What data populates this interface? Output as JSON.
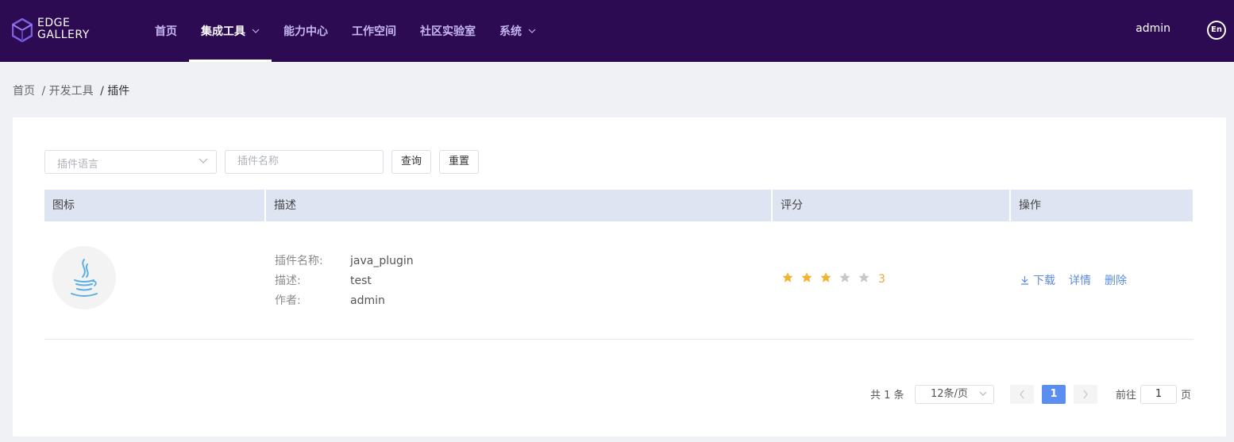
{
  "header": {
    "logo_line1": "EDGE",
    "logo_line2": "GALLERY",
    "nav": [
      {
        "label": "首页",
        "active": false,
        "dropdown": false
      },
      {
        "label": "集成工具",
        "active": true,
        "dropdown": true
      },
      {
        "label": "能力中心",
        "active": false,
        "dropdown": false
      },
      {
        "label": "工作空间",
        "active": false,
        "dropdown": false
      },
      {
        "label": "社区实验室",
        "active": false,
        "dropdown": false
      },
      {
        "label": "系统",
        "active": false,
        "dropdown": true
      }
    ],
    "user": "admin",
    "lang": "En",
    "bg_color": "#2c0b52"
  },
  "breadcrumb": {
    "home": "首页",
    "parent": "/ 开发工具",
    "current": "/ 插件"
  },
  "filters": {
    "language_placeholder": "插件语言",
    "name_placeholder": "插件名称",
    "query_label": "查询",
    "reset_label": "重置"
  },
  "table": {
    "columns": [
      "图标",
      "描述",
      "评分",
      "操作"
    ],
    "rows": [
      {
        "icon": "java-icon",
        "name_label": "插件名称:",
        "name": "java_plugin",
        "desc_label": "描述:",
        "desc": "test",
        "author_label": "作者:",
        "author": "admin",
        "rating": 3,
        "rating_max": 5,
        "rating_text": "3",
        "actions": {
          "download": "下载",
          "detail": "详情",
          "delete": "删除"
        }
      }
    ]
  },
  "pagination": {
    "total": "共 1 条",
    "page_size": "12条/页",
    "current_page": "1",
    "goto_prefix": "前往",
    "goto_value": "1",
    "goto_suffix": "页"
  },
  "colors": {
    "accent": "#5a8ef0",
    "star": "#f2b130",
    "star_empty": "#c8c8c8",
    "link": "#5b8be0"
  }
}
